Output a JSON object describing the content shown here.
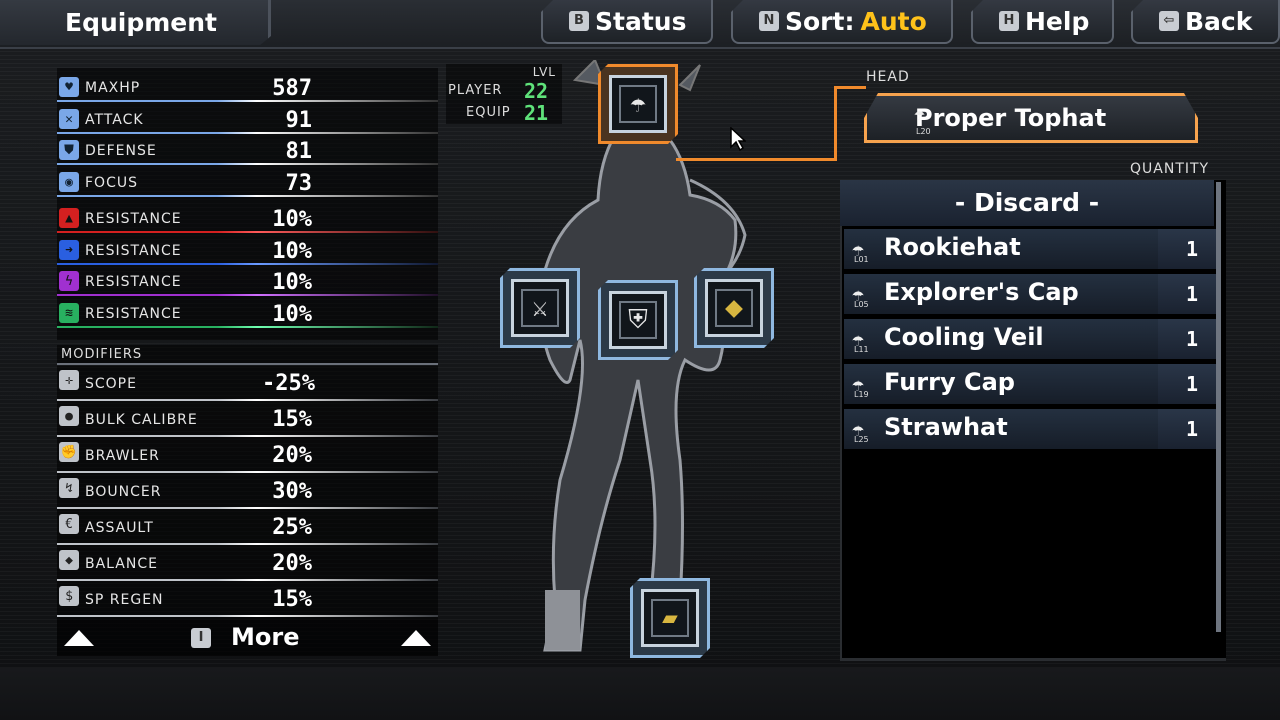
{
  "header": {
    "title": "Equipment",
    "buttons": [
      {
        "key": "B",
        "label": "Status"
      },
      {
        "key": "N",
        "label": "Sort:",
        "value": "Auto"
      },
      {
        "key": "H",
        "label": "Help"
      },
      {
        "key": "⇦",
        "label": "Back"
      }
    ]
  },
  "stats": [
    {
      "label": "MAXHP",
      "value": "587",
      "color": "#7aa7e8",
      "icon": "heart-icon"
    },
    {
      "label": "ATTACK",
      "value": "91",
      "color": "#7aa7e8",
      "icon": "sword-icon"
    },
    {
      "label": "DEFENSE",
      "value": "81",
      "color": "#7aa7e8",
      "icon": "shield-icon"
    },
    {
      "label": "FOCUS",
      "value": "73",
      "color": "#7aa7e8",
      "icon": "eye-icon"
    },
    {
      "label": "RESISTANCE",
      "value": "10%",
      "color": "#d42020",
      "icon": "fire-icon"
    },
    {
      "label": "RESISTANCE",
      "value": "10%",
      "color": "#2a5fe0",
      "icon": "ice-icon"
    },
    {
      "label": "RESISTANCE",
      "value": "10%",
      "color": "#a030d0",
      "icon": "shock-icon"
    },
    {
      "label": "RESISTANCE",
      "value": "10%",
      "color": "#28b060",
      "icon": "wave-icon"
    }
  ],
  "modifiers_title": "MODIFIERS",
  "modifiers": [
    {
      "label": "SCOPE",
      "value": "-25%",
      "icon": "scope-icon"
    },
    {
      "label": "BULK CALIBRE",
      "value": "15%",
      "icon": "bullet-icon"
    },
    {
      "label": "BRAWLER",
      "value": "20%",
      "icon": "fist-icon"
    },
    {
      "label": "BOUNCER",
      "value": "30%",
      "icon": "bounce-icon"
    },
    {
      "label": "ASSAULT",
      "value": "25%",
      "icon": "assault-icon"
    },
    {
      "label": "BALANCE",
      "value": "20%",
      "icon": "balance-icon"
    },
    {
      "label": "SP REGEN",
      "value": "15%",
      "icon": "sp-regen-icon"
    }
  ],
  "more": {
    "key": "I",
    "label": "More"
  },
  "level": {
    "title": "LVL",
    "player_label": "PLAYER",
    "player_value": "22",
    "equip_label": "EQUIP",
    "equip_value": "21"
  },
  "slots": {
    "head": "hat-icon",
    "left_arm": "sword-icon",
    "torso": "armor-icon",
    "right_arm": "shield-icon",
    "feet": "boot-icon"
  },
  "selected": {
    "section_label": "HEAD",
    "item_name": "Proper Tophat",
    "item_level": "L20"
  },
  "quantity_label": "QUANTITY",
  "discard_label": "- Discard -",
  "items": [
    {
      "name": "Rookiehat",
      "level": "L01",
      "qty": "1"
    },
    {
      "name": "Explorer's Cap",
      "level": "L05",
      "qty": "1"
    },
    {
      "name": "Cooling Veil",
      "level": "L11",
      "qty": "1"
    },
    {
      "name": "Furry Cap",
      "level": "L19",
      "qty": "1"
    },
    {
      "name": "Strawhat",
      "level": "L25",
      "qty": "1"
    }
  ]
}
